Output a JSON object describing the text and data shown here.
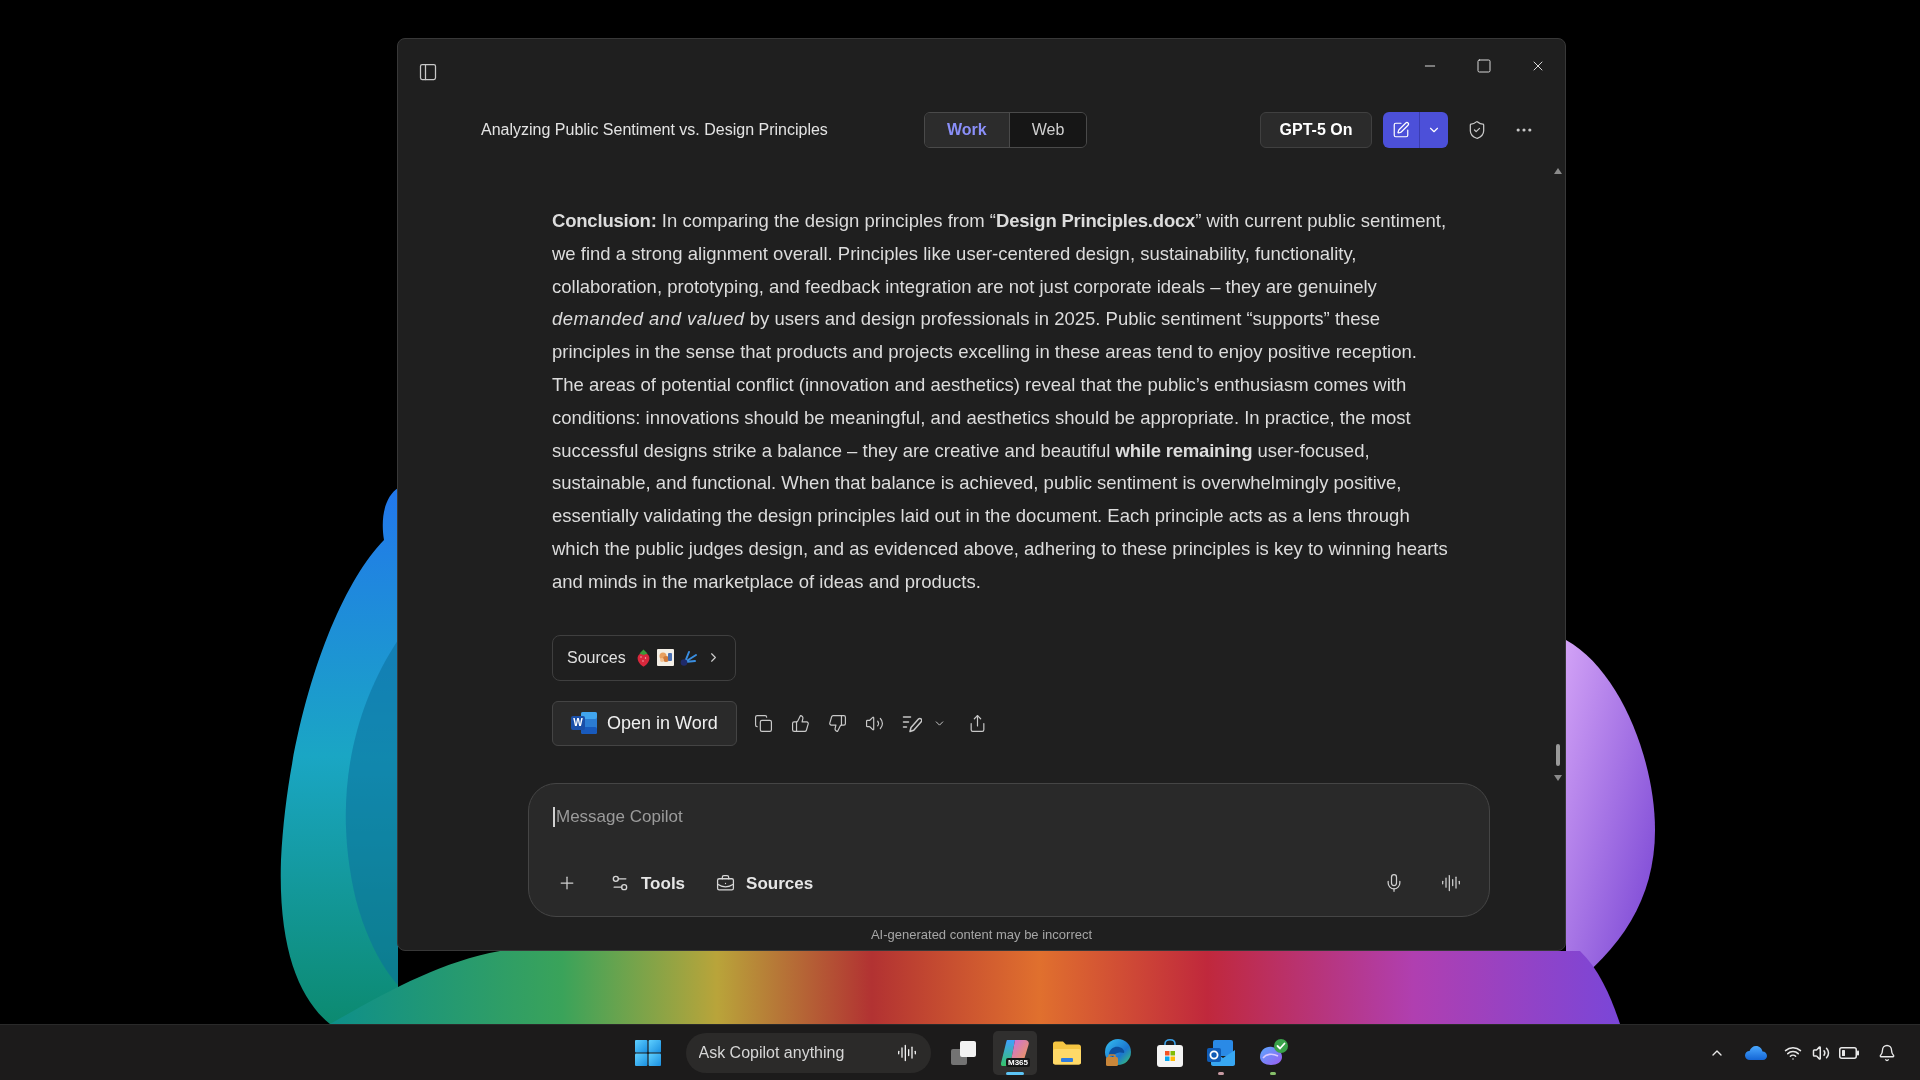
{
  "window": {
    "title": "Analyzing Public Sentiment vs. Design Principles"
  },
  "mode_tabs": [
    {
      "label": "Work",
      "selected": true
    },
    {
      "label": "Web",
      "selected": false
    }
  ],
  "model_button": {
    "label": "GPT-5 On"
  },
  "response": {
    "text": "**Conclusion:** In comparing the design principles from “**Design Principles.docx**” with current public sentiment, we find a strong alignment overall. Principles like user-centered design, sustainability, functionality, collaboration, prototyping, and feedback integration are not just corporate ideals – they are genuinely *demanded and valued* by users and design professionals in 2025. Public sentiment “supports” these principles in the sense that products and projects excelling in these areas tend to enjoy positive reception. The areas of potential conflict (innovation and aesthetics) reveal that the public’s enthusiasm comes with conditions: innovations should be meaningful, and aesthetics should be appropriate. In practice, the most successful designs strike a balance – they are creative and beautiful **while remaining** user-focused, sustainable, and functional. When that balance is achieved, public sentiment is overwhelmingly positive, essentially validating the design principles laid out in the document. Each principle acts as a lens through which the public judges design, and as evidenced above, adhering to these principles is key to winning hearts and minds in the marketplace of ideas and products.",
    "sources_button": {
      "label": "Sources"
    },
    "open_button": {
      "label": "Open in Word",
      "icon_letter": "W"
    }
  },
  "composer": {
    "placeholder": "Message Copilot",
    "tools": [
      {
        "kind": "tools",
        "label": "Tools"
      },
      {
        "kind": "sources",
        "label": "Sources"
      }
    ],
    "disclaimer": "AI-generated content may be incorrect"
  },
  "taskbar": {
    "search": {
      "placeholder": "Ask Copilot anything"
    },
    "apps": [
      {
        "kind": "taskview",
        "selected": false
      },
      {
        "kind": "swirl",
        "selected": true,
        "badge": "M365",
        "color": "#5cc4f5"
      },
      {
        "kind": "folder",
        "selected": false
      },
      {
        "kind": "browser",
        "selected": false
      },
      {
        "kind": "store",
        "selected": false
      },
      {
        "kind": "mail",
        "selected": false,
        "color": "#c79aa2"
      },
      {
        "kind": "swirlcheck",
        "selected": false,
        "color": "#86c06a"
      }
    ]
  }
}
